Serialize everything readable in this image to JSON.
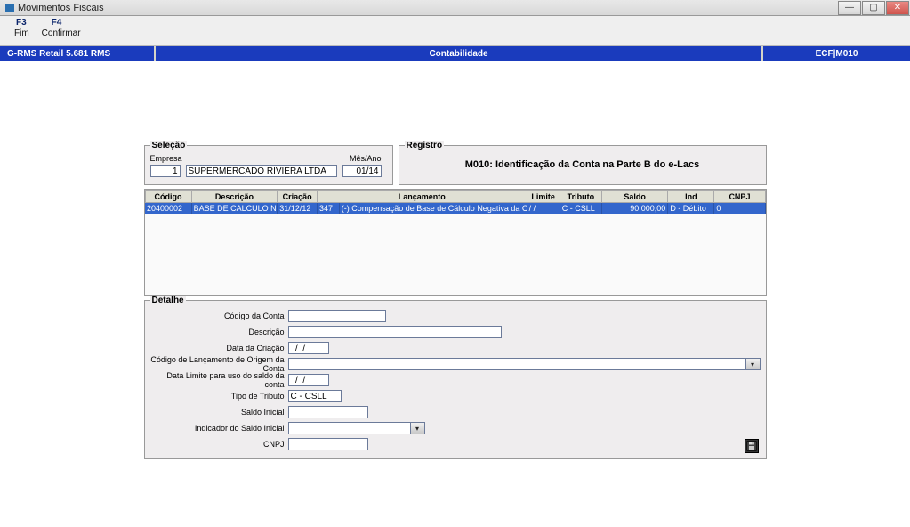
{
  "window": {
    "title": "Movimentos Fiscais"
  },
  "menu": {
    "f3": "F3",
    "f4": "F4",
    "fim": "Fim",
    "confirmar": "Confirmar"
  },
  "bluebar": {
    "left": "G-RMS Retail 5.681 RMS",
    "mid": "Contabilidade",
    "right": "ECF|M010"
  },
  "selecao": {
    "legend": "Seleção",
    "empresa_label": "Empresa",
    "empresa_code": "1",
    "empresa_name": "SUPERMERCADO RIVIERA LTDA",
    "mesano_label": "Mês/Ano",
    "mesano": "01/14"
  },
  "registro": {
    "legend": "Registro",
    "text": "M010: Identificação da Conta na Parte B do e-Lacs"
  },
  "grid": {
    "headers": {
      "codigo": "Código",
      "descricao": "Descrição",
      "criacao": "Criação",
      "lancamento": "Lançamento",
      "limite": "Limite",
      "tributo": "Tributo",
      "saldo": "Saldo",
      "ind": "Ind",
      "cnpj": "CNPJ"
    },
    "rows": [
      {
        "codigo": "20400002",
        "descricao": "BASE DE CALCULO NEGA",
        "criacao": "31/12/12",
        "lanc_cod": "347",
        "lanc_desc": "(-) Compensação de Base de Cálculo Negativa da CS",
        "limite": "  /  /",
        "tributo": "C - CSLL",
        "saldo": "90.000,00",
        "ind": "D - Débito",
        "cnpj": "0"
      }
    ]
  },
  "detalhe": {
    "legend": "Detalhe",
    "labels": {
      "codigo_conta": "Código da Conta",
      "descricao": "Descrição",
      "data_criacao": "Data da Criação",
      "cod_lanc_origem": "Código de Lançamento de Origem da Conta",
      "data_limite": "Data Limite para uso do saldo da conta",
      "tipo_tributo": "Tipo de Tributo",
      "saldo_inicial": "Saldo Inicial",
      "ind_saldo_inicial": "Indicador do Saldo Inicial",
      "cnpj": "CNPJ"
    },
    "values": {
      "codigo_conta": "",
      "descricao": "",
      "data_criacao": "  /  /",
      "cod_lanc_origem": "",
      "data_limite": "  /  /",
      "tipo_tributo": "C - CSLL",
      "saldo_inicial": "",
      "ind_saldo_inicial": "",
      "cnpj": ""
    }
  }
}
